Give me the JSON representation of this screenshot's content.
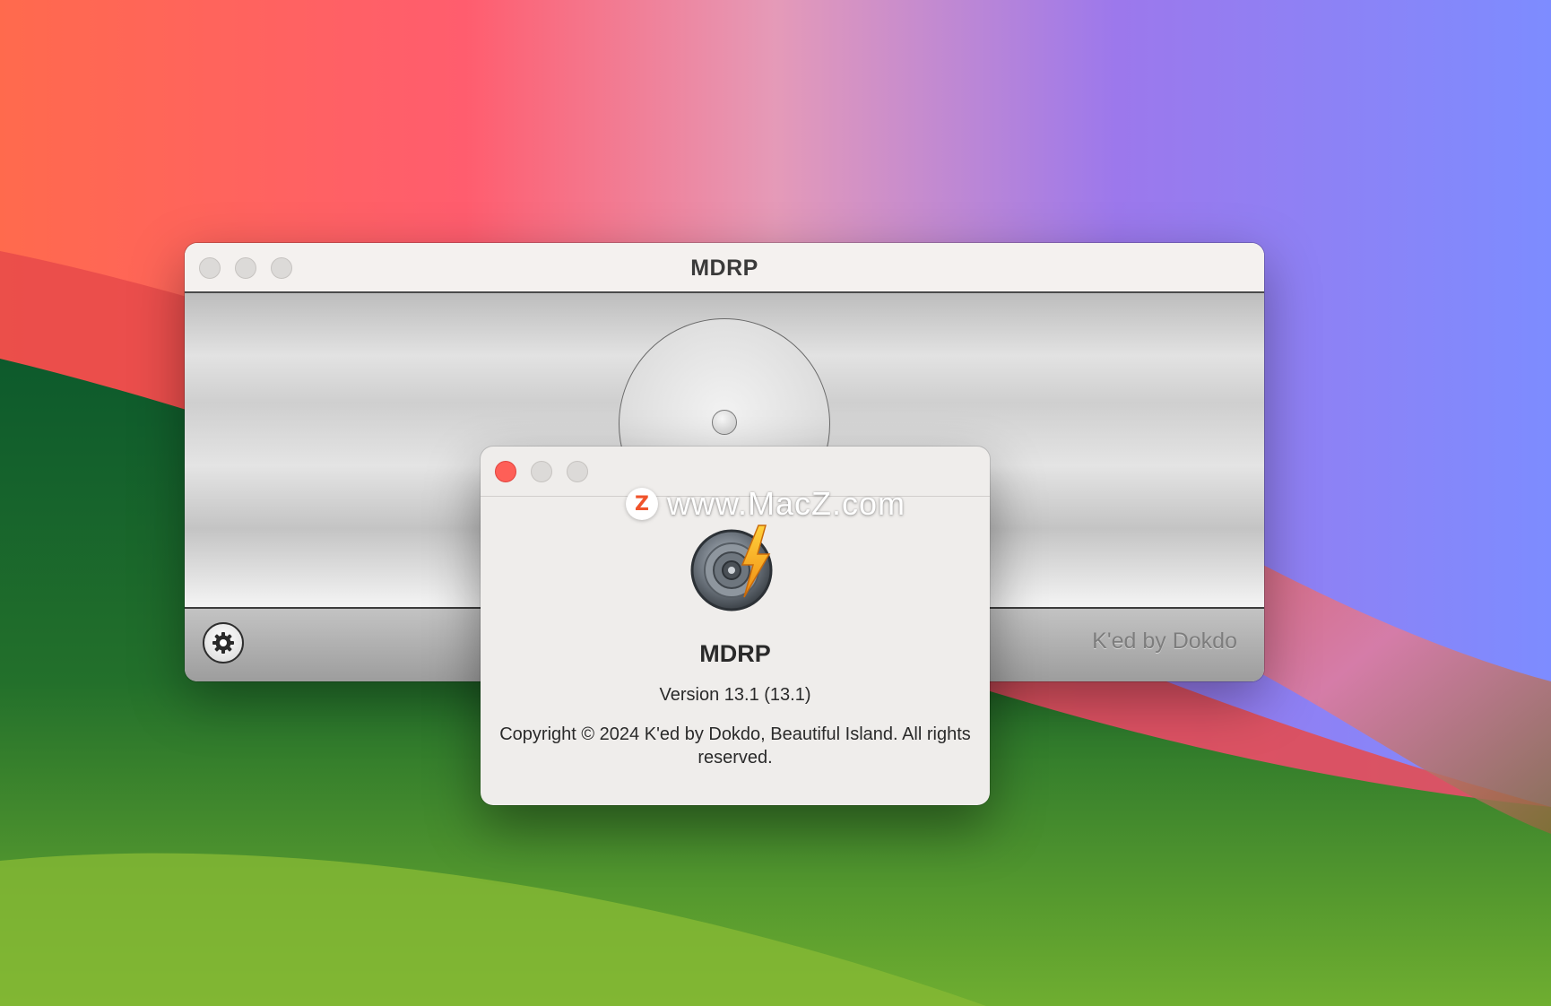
{
  "main_window": {
    "title": "MDRP",
    "credit": "K'ed by Dokdo",
    "traffic_lights": [
      "close",
      "minimize",
      "zoom"
    ],
    "settings_icon": "gear-icon"
  },
  "about_dialog": {
    "app_name": "MDRP",
    "version": "Version 13.1 (13.1)",
    "copyright": "Copyright © 2024 K'ed by Dokdo, Beautiful Island. All rights reserved.",
    "app_icon": "disc-lightning-icon",
    "close_color": "#fe5f57"
  },
  "watermark": {
    "badge": "Z",
    "text": "www.MacZ.com"
  }
}
